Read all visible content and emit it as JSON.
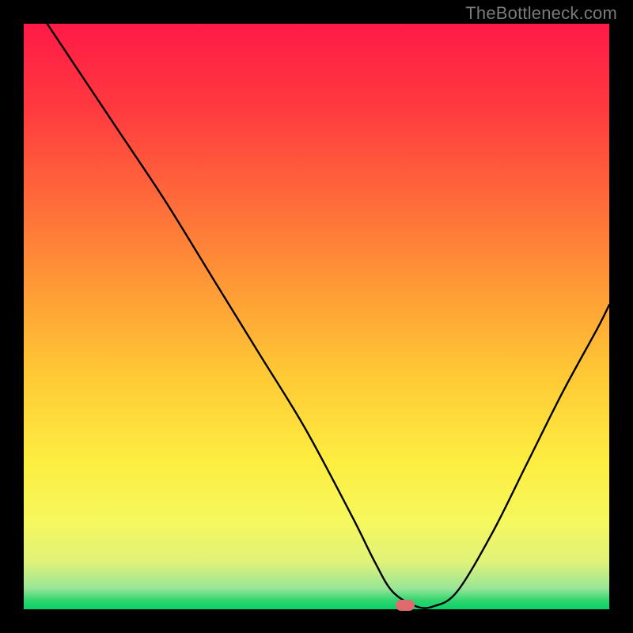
{
  "watermark": {
    "text": "TheBottleneck.com"
  },
  "marker": {
    "x_frac": 0.652,
    "y_frac": 0.992
  },
  "chart_data": {
    "type": "line",
    "title": "",
    "xlabel": "",
    "ylabel": "",
    "xlim": [
      0,
      1
    ],
    "ylim": [
      0,
      1
    ],
    "x": [
      0.0,
      0.08,
      0.16,
      0.24,
      0.32,
      0.4,
      0.48,
      0.56,
      0.6,
      0.63,
      0.67,
      0.7,
      0.74,
      0.8,
      0.86,
      0.92,
      0.98,
      1.0
    ],
    "values": [
      1.06,
      0.94,
      0.82,
      0.7,
      0.57,
      0.44,
      0.31,
      0.16,
      0.08,
      0.03,
      0.005,
      0.005,
      0.03,
      0.13,
      0.25,
      0.37,
      0.48,
      0.52
    ],
    "background_gradient": {
      "top": "#ff1a47",
      "mid": "#fdee41",
      "bottom": "#0ad16a"
    }
  }
}
